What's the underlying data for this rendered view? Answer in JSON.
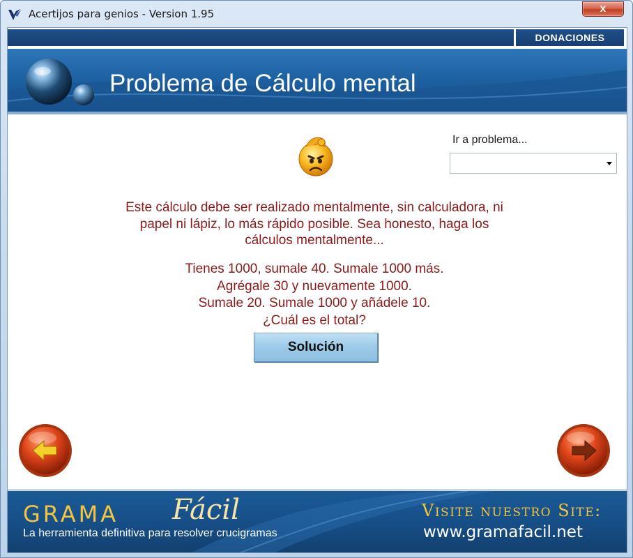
{
  "window": {
    "title": "Acertijos para genios - Version 1.95",
    "close_glyph": "x"
  },
  "header": {
    "donate_label": "DONACIONES",
    "title": "Problema de Cálculo mental"
  },
  "goto": {
    "label": "Ir a problema...",
    "selected_value": ""
  },
  "problem": {
    "intro_lines": [
      "Este cálculo debe ser realizado mentalmente, sin calculadora, ni",
      "papel ni lápiz, lo más rápido posible. Sea honesto, haga los",
      "cálculos mentalmente..."
    ],
    "puzzle_lines": [
      "Tienes 1000, sumale 40. Sumale 1000 más.",
      "Agrégale 30 y nuevamente 1000.",
      "Sumale 20. Sumale 1000 y añádele 10.",
      "¿Cuál es el total?"
    ],
    "solution_label": "Solución"
  },
  "navigation": {
    "prev_icon": "arrow-left-icon",
    "next_icon": "arrow-right-icon"
  },
  "footer": {
    "logo_part1": "GRAMA",
    "logo_part2": "Fácil",
    "tagline": "La herramienta definitiva para resolver crucigramas",
    "visit_label": "Visite nuestro Site:",
    "site_url": "www.gramafacil.net"
  },
  "colors": {
    "banner_blue": "#1e62a3",
    "text_red": "#8b1a1a",
    "logo_gold": "#f0c640",
    "nav_orange": "#e0461a",
    "solution_button": "#9ccae8"
  }
}
